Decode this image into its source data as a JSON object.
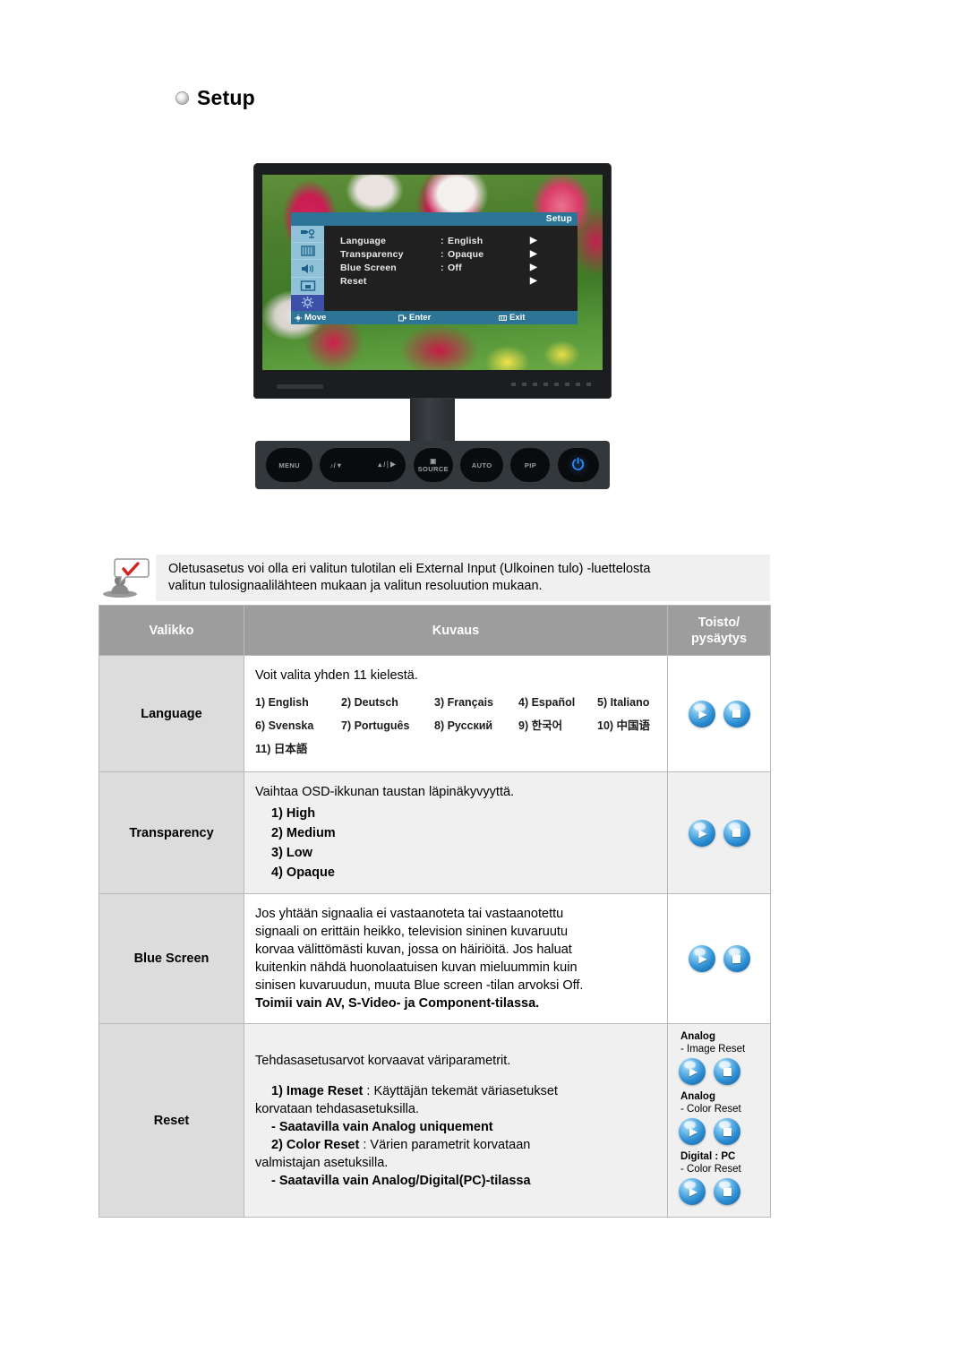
{
  "page": {
    "title": "Setup",
    "title_bullet_icon": "gear-bullet-icon"
  },
  "monitor": {
    "osd": {
      "title": "Setup",
      "rows": [
        {
          "label": "Language",
          "colon": ":",
          "value": "English",
          "arrow": "▶"
        },
        {
          "label": "Transparency",
          "colon": ":",
          "value": "Opaque",
          "arrow": "▶"
        },
        {
          "label": "Blue Screen",
          "colon": ":",
          "value": "Off",
          "arrow": "▶"
        },
        {
          "label": "Reset",
          "colon": "",
          "value": "",
          "arrow": "▶"
        }
      ],
      "sidebar_icons": [
        "input-source-icon",
        "picture-icon",
        "sound-icon",
        "pip-icon",
        "setup-gear-icon"
      ],
      "selected_sidebar_icon": "setup-gear-icon",
      "footer": [
        {
          "icon": "move-icon",
          "label": "Move"
        },
        {
          "icon": "enter-icon",
          "label": "Enter"
        },
        {
          "icon": "exit-icon",
          "label": "Exit"
        }
      ],
      "colors": {
        "title_bar": "#2c7596",
        "body": "#202020",
        "sidebar": "#8fc2d9",
        "selected": "#3d4fa8"
      }
    },
    "buttons": [
      {
        "name": "menu-button",
        "label": "MENU"
      },
      {
        "name": "volume-button",
        "label_left": "♪/▼",
        "label_right": "▲/⏐▶"
      },
      {
        "name": "source-button",
        "label_top": "▣",
        "label": "SOURCE"
      },
      {
        "name": "auto-button",
        "label": "AUTO"
      },
      {
        "name": "pip-button",
        "label": "PIP"
      },
      {
        "name": "power-button",
        "label": "⏻"
      }
    ]
  },
  "note": {
    "icon": "note-figure-icon",
    "line1": "Oletusasetus voi olla eri valitun tulotilan eli External Input (Ulkoinen tulo) -luettelosta",
    "line2": "valitun tulosignaalilähteen mukaan ja valitun resoluution mukaan."
  },
  "table": {
    "headers": {
      "menu": "Valikko",
      "description": "Kuvaus",
      "play_line1": "Toisto/",
      "play_line2": "pysäytys"
    },
    "rows": {
      "language": {
        "menu": "Language",
        "intro": "Voit valita yhden 11 kielestä.",
        "languages": [
          "1) English",
          "2) Deutsch",
          "3) Français",
          "4) Español",
          "5) Italiano",
          "6) Svenska",
          "7) Português",
          "8) Русский",
          "9) 한국어",
          "10) 中国语",
          "11) 日本語"
        ]
      },
      "transparency": {
        "menu": "Transparency",
        "intro": "Vaihtaa OSD-ikkunan taustan läpinäkyvyyttä.",
        "options": [
          "1) High",
          "2) Medium",
          "3) Low",
          "4) Opaque"
        ]
      },
      "blue_screen": {
        "menu": "Blue Screen",
        "line1": "Jos yhtään signaalia ei vastaanoteta tai vastaanotettu",
        "line2": "signaali on erittäin heikko, television sininen kuvaruutu",
        "line3": "korvaa välittömästi kuvan, jossa on häiriöitä. Jos haluat",
        "line4": "kuitenkin nähdä huonolaatuisen kuvan mieluummin kuin",
        "line5": "sinisen kuvaruudun, muuta Blue screen -tilan arvoksi Off.",
        "bold_note": "Toimii vain AV, S-Video- ja Component-tilassa."
      },
      "reset": {
        "menu": "Reset",
        "intro": "Tehdasasetusarvot korvaavat väriparametrit.",
        "item1_bold": "1) Image Reset",
        "item1_text": " : Käyttäjän tekemät väriasetukset",
        "item1_cont": "korvataan tehdasasetuksilla.",
        "item1_note": "- Saatavilla vain Analog uniquement",
        "item2_bold": "2) Color Reset",
        "item2_text": " : Värien parametrit korvataan",
        "item2_cont": "valmistajan asetuksilla.",
        "item2_note": "- Saatavilla vain Analog/Digital(PC)-tilassa",
        "groups": [
          {
            "title": "Analog",
            "sub": "- Image Reset"
          },
          {
            "title": "Analog",
            "sub": "- Color Reset"
          },
          {
            "title": "Digital : PC",
            "sub": "- Color Reset"
          }
        ]
      }
    },
    "play_button_icons": {
      "play": "play-sphere-icon",
      "stop": "stop-sphere-icon"
    }
  }
}
